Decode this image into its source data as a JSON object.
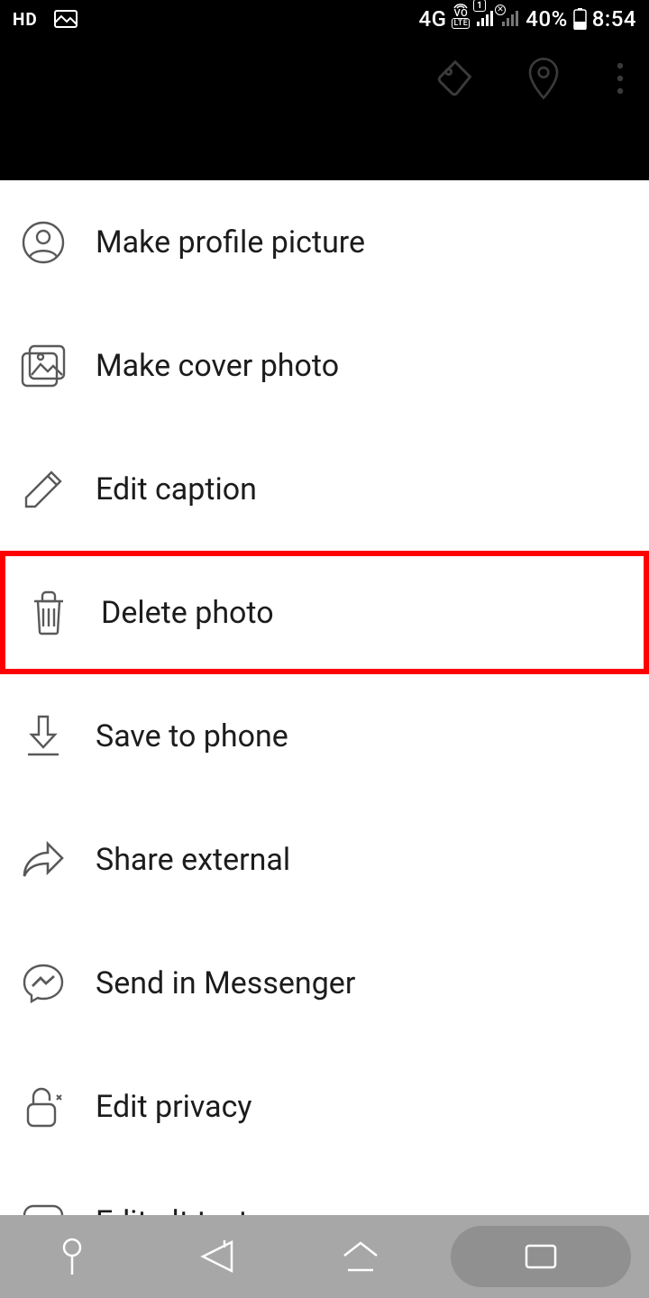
{
  "status_bar": {
    "hd": "HD",
    "network": "4G",
    "volte_vo": "VO",
    "volte_lte": "LTE",
    "sim_num": "1",
    "battery": "40%",
    "time": "8:54"
  },
  "menu": {
    "items": [
      {
        "label": "Make profile picture"
      },
      {
        "label": "Make cover photo"
      },
      {
        "label": "Edit caption"
      },
      {
        "label": "Delete photo"
      },
      {
        "label": "Save to phone"
      },
      {
        "label": "Share external"
      },
      {
        "label": "Send in Messenger"
      },
      {
        "label": "Edit privacy"
      },
      {
        "label": "Edit alt text"
      }
    ]
  }
}
